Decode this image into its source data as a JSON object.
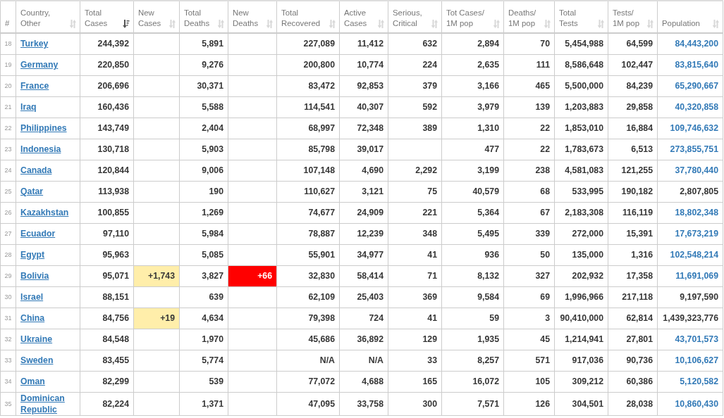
{
  "table": {
    "columns": [
      {
        "label": "#",
        "sortable": false
      },
      {
        "label": "Country,\nOther",
        "sortable": true,
        "sorted": false
      },
      {
        "label": "Total\nCases",
        "sortable": true,
        "sorted": true
      },
      {
        "label": "New\nCases",
        "sortable": true,
        "sorted": false
      },
      {
        "label": "Total\nDeaths",
        "sortable": true,
        "sorted": false
      },
      {
        "label": "New\nDeaths",
        "sortable": true,
        "sorted": false
      },
      {
        "label": "Total\nRecovered",
        "sortable": true,
        "sorted": false
      },
      {
        "label": "Active\nCases",
        "sortable": true,
        "sorted": false
      },
      {
        "label": "Serious,\nCritical",
        "sortable": true,
        "sorted": false
      },
      {
        "label": "Tot Cases/\n1M pop",
        "sortable": true,
        "sorted": false
      },
      {
        "label": "Deaths/\n1M pop",
        "sortable": true,
        "sorted": false
      },
      {
        "label": "Total\nTests",
        "sortable": true,
        "sorted": false
      },
      {
        "label": "Tests/\n1M pop",
        "sortable": true,
        "sorted": false
      },
      {
        "label": "Population",
        "sortable": true,
        "sorted": false
      }
    ],
    "rows": [
      {
        "rank": "18",
        "country": "Turkey",
        "total_cases": "244,392",
        "total_deaths": "5,891",
        "total_recovered": "227,089",
        "active_cases": "11,412",
        "serious": "632",
        "cases_per_1m": "2,894",
        "deaths_per_1m": "70",
        "total_tests": "5,454,988",
        "tests_per_1m": "64,599",
        "population": "84,443,200",
        "population_link": true
      },
      {
        "rank": "19",
        "country": "Germany",
        "total_cases": "220,850",
        "total_deaths": "9,276",
        "total_recovered": "200,800",
        "active_cases": "10,774",
        "serious": "224",
        "cases_per_1m": "2,635",
        "deaths_per_1m": "111",
        "total_tests": "8,586,648",
        "tests_per_1m": "102,447",
        "population": "83,815,640",
        "population_link": true
      },
      {
        "rank": "20",
        "country": "France",
        "total_cases": "206,696",
        "total_deaths": "30,371",
        "total_recovered": "83,472",
        "active_cases": "92,853",
        "serious": "379",
        "cases_per_1m": "3,166",
        "deaths_per_1m": "465",
        "total_tests": "5,500,000",
        "tests_per_1m": "84,239",
        "population": "65,290,667",
        "population_link": true
      },
      {
        "rank": "21",
        "country": "Iraq",
        "total_cases": "160,436",
        "total_deaths": "5,588",
        "total_recovered": "114,541",
        "active_cases": "40,307",
        "serious": "592",
        "cases_per_1m": "3,979",
        "deaths_per_1m": "139",
        "total_tests": "1,203,883",
        "tests_per_1m": "29,858",
        "population": "40,320,858",
        "population_link": true
      },
      {
        "rank": "22",
        "country": "Philippines",
        "total_cases": "143,749",
        "total_deaths": "2,404",
        "total_recovered": "68,997",
        "active_cases": "72,348",
        "serious": "389",
        "cases_per_1m": "1,310",
        "deaths_per_1m": "22",
        "total_tests": "1,853,010",
        "tests_per_1m": "16,884",
        "population": "109,746,632",
        "population_link": true
      },
      {
        "rank": "23",
        "country": "Indonesia",
        "total_cases": "130,718",
        "total_deaths": "5,903",
        "total_recovered": "85,798",
        "active_cases": "39,017",
        "cases_per_1m": "477",
        "deaths_per_1m": "22",
        "total_tests": "1,783,673",
        "tests_per_1m": "6,513",
        "population": "273,855,751",
        "population_link": true
      },
      {
        "rank": "24",
        "country": "Canada",
        "total_cases": "120,844",
        "total_deaths": "9,006",
        "total_recovered": "107,148",
        "active_cases": "4,690",
        "serious": "2,292",
        "cases_per_1m": "3,199",
        "deaths_per_1m": "238",
        "total_tests": "4,581,083",
        "tests_per_1m": "121,255",
        "population": "37,780,440",
        "population_link": true
      },
      {
        "rank": "25",
        "country": "Qatar",
        "total_cases": "113,938",
        "total_deaths": "190",
        "total_recovered": "110,627",
        "active_cases": "3,121",
        "serious": "75",
        "cases_per_1m": "40,579",
        "deaths_per_1m": "68",
        "total_tests": "533,995",
        "tests_per_1m": "190,182",
        "population": "2,807,805",
        "population_link": false
      },
      {
        "rank": "26",
        "country": "Kazakhstan",
        "total_cases": "100,855",
        "total_deaths": "1,269",
        "total_recovered": "74,677",
        "active_cases": "24,909",
        "serious": "221",
        "cases_per_1m": "5,364",
        "deaths_per_1m": "67",
        "total_tests": "2,183,308",
        "tests_per_1m": "116,119",
        "population": "18,802,348",
        "population_link": true
      },
      {
        "rank": "27",
        "country": "Ecuador",
        "total_cases": "97,110",
        "total_deaths": "5,984",
        "total_recovered": "78,887",
        "active_cases": "12,239",
        "serious": "348",
        "cases_per_1m": "5,495",
        "deaths_per_1m": "339",
        "total_tests": "272,000",
        "tests_per_1m": "15,391",
        "population": "17,673,219",
        "population_link": true
      },
      {
        "rank": "28",
        "country": "Egypt",
        "total_cases": "95,963",
        "total_deaths": "5,085",
        "total_recovered": "55,901",
        "active_cases": "34,977",
        "serious": "41",
        "cases_per_1m": "936",
        "deaths_per_1m": "50",
        "total_tests": "135,000",
        "tests_per_1m": "1,316",
        "population": "102,548,214",
        "population_link": true
      },
      {
        "rank": "29",
        "country": "Bolivia",
        "total_cases": "95,071",
        "new_cases": "+1,743",
        "total_deaths": "3,827",
        "new_deaths": "+66",
        "total_recovered": "32,830",
        "active_cases": "58,414",
        "serious": "71",
        "cases_per_1m": "8,132",
        "deaths_per_1m": "327",
        "total_tests": "202,932",
        "tests_per_1m": "17,358",
        "population": "11,691,069",
        "population_link": true
      },
      {
        "rank": "30",
        "country": "Israel",
        "total_cases": "88,151",
        "total_deaths": "639",
        "total_recovered": "62,109",
        "active_cases": "25,403",
        "serious": "369",
        "cases_per_1m": "9,584",
        "deaths_per_1m": "69",
        "total_tests": "1,996,966",
        "tests_per_1m": "217,118",
        "population": "9,197,590",
        "population_link": false
      },
      {
        "rank": "31",
        "country": "China",
        "total_cases": "84,756",
        "new_cases": "+19",
        "total_deaths": "4,634",
        "total_recovered": "79,398",
        "active_cases": "724",
        "serious": "41",
        "cases_per_1m": "59",
        "deaths_per_1m": "3",
        "total_tests": "90,410,000",
        "tests_per_1m": "62,814",
        "population": "1,439,323,776",
        "population_link": false
      },
      {
        "rank": "32",
        "country": "Ukraine",
        "total_cases": "84,548",
        "total_deaths": "1,970",
        "total_recovered": "45,686",
        "active_cases": "36,892",
        "serious": "129",
        "cases_per_1m": "1,935",
        "deaths_per_1m": "45",
        "total_tests": "1,214,941",
        "tests_per_1m": "27,801",
        "population": "43,701,573",
        "population_link": true
      },
      {
        "rank": "33",
        "country": "Sweden",
        "total_cases": "83,455",
        "total_deaths": "5,774",
        "total_recovered": "N/A",
        "active_cases": "N/A",
        "serious": "33",
        "cases_per_1m": "8,257",
        "deaths_per_1m": "571",
        "total_tests": "917,036",
        "tests_per_1m": "90,736",
        "population": "10,106,627",
        "population_link": true
      },
      {
        "rank": "34",
        "country": "Oman",
        "total_cases": "82,299",
        "total_deaths": "539",
        "total_recovered": "77,072",
        "active_cases": "4,688",
        "serious": "165",
        "cases_per_1m": "16,072",
        "deaths_per_1m": "105",
        "total_tests": "309,212",
        "tests_per_1m": "60,386",
        "population": "5,120,582",
        "population_link": true
      },
      {
        "rank": "35",
        "country": "Dominican Republic",
        "total_cases": "82,224",
        "total_deaths": "1,371",
        "total_recovered": "47,095",
        "active_cases": "33,758",
        "serious": "300",
        "cases_per_1m": "7,571",
        "deaths_per_1m": "126",
        "total_tests": "304,501",
        "tests_per_1m": "28,038",
        "population": "10,860,430",
        "population_link": true
      }
    ]
  }
}
